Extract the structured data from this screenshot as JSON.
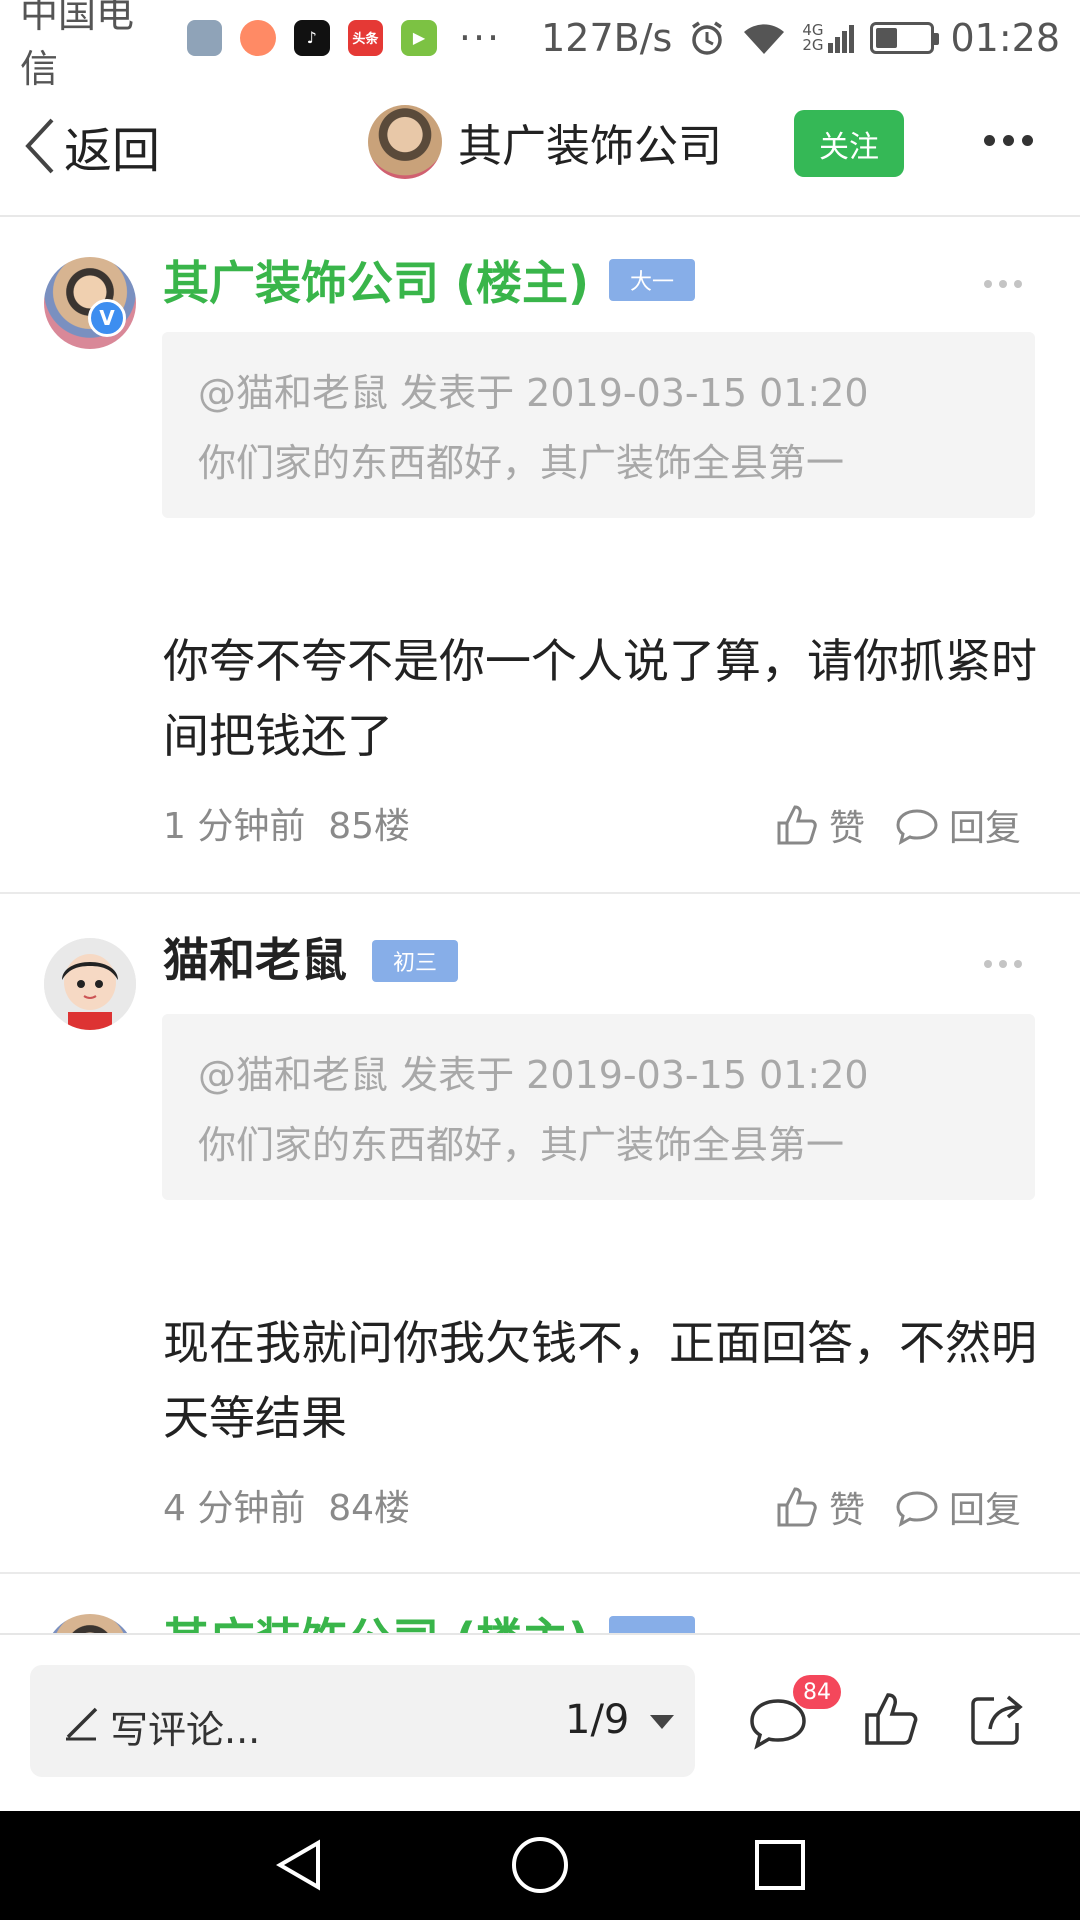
{
  "status_bar": {
    "carrier": "中国电信",
    "more": "···",
    "net_speed": "127B/s",
    "network": "4G\n2G",
    "time": "01:28",
    "battery_level": 0.4,
    "app_icon_text": "头条"
  },
  "nav": {
    "back_label": "返回",
    "title": "其广装饰公司",
    "follow_label": "关注"
  },
  "posts": [
    {
      "author": "其广装饰公司 (楼主)",
      "level": "大一",
      "quote_line1": "@猫和老鼠 发表于 2019-03-15 01:20",
      "quote_line2": "你们家的东西都好，其广装饰全县第一",
      "body": "你夸不夸不是你一个人说了算，请你抓紧时间把钱还了",
      "time": "1 分钟前",
      "floor": "85楼",
      "like_label": "赞",
      "reply_label": "回复"
    },
    {
      "author": "猫和老鼠",
      "level": "初三",
      "quote_line1": "@猫和老鼠 发表于 2019-03-15 01:20",
      "quote_line2": "你们家的东西都好，其广装饰全县第一",
      "body": "现在我就问你我欠钱不，正面回答，不然明天等结果",
      "time": "4 分钟前",
      "floor": "84楼",
      "like_label": "赞",
      "reply_label": "回复"
    },
    {
      "author": "其广装饰公司 (楼主)"
    }
  ],
  "bottom_bar": {
    "comment_placeholder": "写评论...",
    "page": "1/9",
    "comment_count": "84"
  },
  "colors": {
    "accent_green": "#35b856",
    "level_badge": "#87aee8",
    "badge_red": "#f4475b"
  }
}
